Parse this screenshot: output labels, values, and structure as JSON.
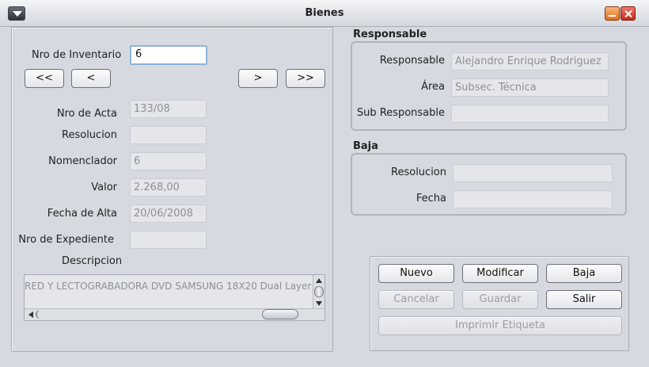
{
  "window": {
    "title": "Bienes"
  },
  "left": {
    "inventory_label": "Nro de Inventario",
    "inventory_value": "6",
    "nav": {
      "first": "<<",
      "prev": "<",
      "next": ">",
      "last": ">>"
    },
    "fields": [
      {
        "label": "Nro de Acta",
        "value": "133/08"
      },
      {
        "label": "Resolucion",
        "value": ""
      },
      {
        "label": "Nomenclador",
        "value": "6"
      },
      {
        "label": "Valor",
        "value": "2.268,00"
      },
      {
        "label": "Fecha de Alta",
        "value": "20/06/2008"
      },
      {
        "label": "Nro de Expediente",
        "value": ""
      }
    ],
    "description_label": "Descripcion",
    "description_value": "RED Y LECTOGRABADORA DVD SAMSUNG 18X20 Dual Layer,"
  },
  "responsable": {
    "title": "Responsable",
    "fields": [
      {
        "label": "Responsable",
        "value": "Alejandro Enrique Rodriguez"
      },
      {
        "label": "Área",
        "value": "Subsec. Técnica"
      },
      {
        "label": "Sub Responsable",
        "value": ""
      }
    ]
  },
  "baja": {
    "title": "Baja",
    "fields": [
      {
        "label": "Resolucion",
        "value": ""
      },
      {
        "label": "Fecha",
        "value": ""
      }
    ]
  },
  "actions": {
    "nuevo": "Nuevo",
    "modificar": "Modificar",
    "baja": "Baja",
    "cancelar": "Cancelar",
    "guardar": "Guardar",
    "salir": "Salir",
    "imprimir": "Imprimir Etiqueta"
  }
}
